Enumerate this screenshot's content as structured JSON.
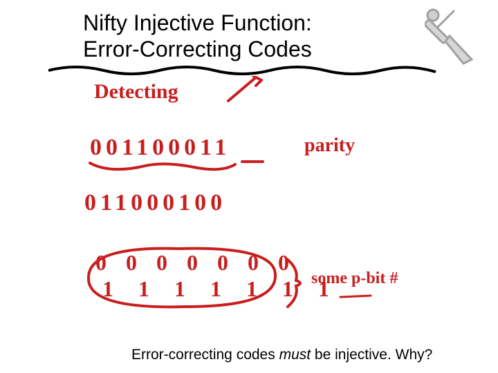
{
  "title": {
    "line1": "Nifty Injective Function:",
    "line2": "Error-Correcting Codes"
  },
  "handwriting": {
    "detecting": "Detecting",
    "bits1": "001100011",
    "parity": "parity",
    "bits2": "011000100",
    "zeros_top": "0 0 0 0 0 0 0",
    "zeros_bot": "1 1 1 1 1 1 1",
    "some_pbit": "some  p-bit #"
  },
  "footer": {
    "prefix": "Error-correcting codes ",
    "emph": "must",
    "suffix": " be injective.  Why?"
  },
  "colors": {
    "ink": "#c81e1e",
    "sword": "#b9b9b9",
    "text": "#000000"
  }
}
